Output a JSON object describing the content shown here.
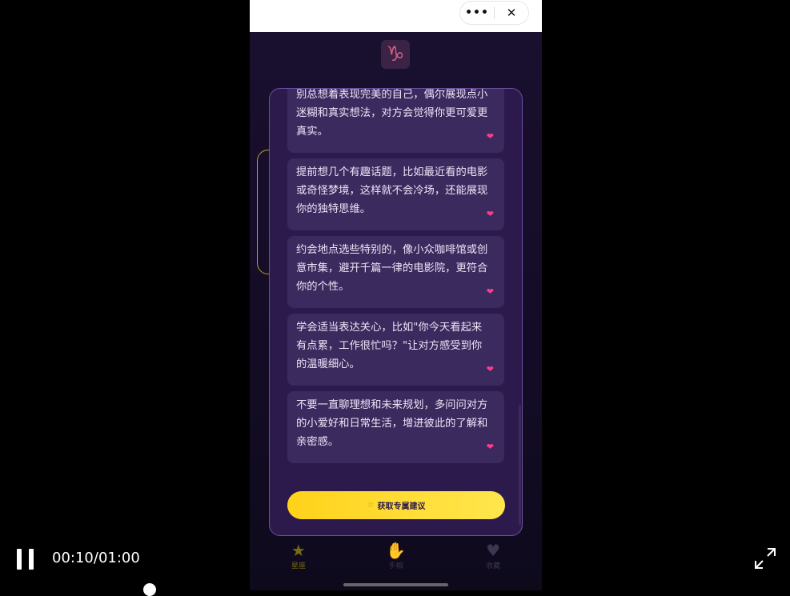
{
  "header": {
    "more_label": "•••",
    "close_label": "✕"
  },
  "zodiac": {
    "symbol": "♑"
  },
  "tips": [
    {
      "text": "别总想着表现完美的自己，偶尔展现点小迷糊和真实想法，对方会觉得你更可爱更真实。"
    },
    {
      "text": "提前想几个有趣话题，比如最近看的电影或奇怪梦境，这样就不会冷场，还能展现你的独特思维。"
    },
    {
      "text": "约会地点选些特别的，像小众咖啡馆或创意市集，避开千篇一律的电影院，更符合你的个性。"
    },
    {
      "text": "学会适当表达关心，比如\"你今天看起来有点累，工作很忙吗？\"让对方感受到你的温暖细心。"
    },
    {
      "text": "不要一直聊理想和未来规划，多问问对方的小爱好和日常生活，增进彼此的了解和亲密感。"
    }
  ],
  "cta": {
    "label": "获取专属建议"
  },
  "tabbar": {
    "items": [
      {
        "label": "星座",
        "icon": "star-icon"
      },
      {
        "label": "手相",
        "icon": "hand-icon"
      },
      {
        "label": "收藏",
        "icon": "heart-icon"
      }
    ]
  },
  "player": {
    "timecode": "00:10/01:00",
    "progress": 0.167
  },
  "colors": {
    "accent": "#ffd21a",
    "heart": "#ff3d8b",
    "modal": "#2c1a4c"
  }
}
